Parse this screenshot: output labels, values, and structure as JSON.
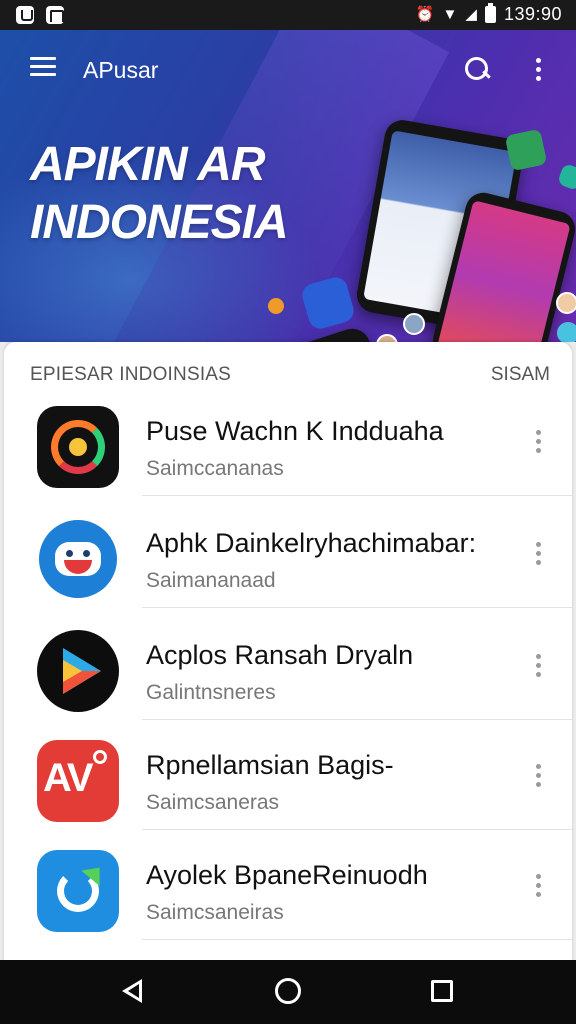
{
  "status_bar": {
    "time": "139:90",
    "icons": [
      "notification-icon",
      "notification-icon",
      "alarm-icon",
      "wifi-icon",
      "signal-icon",
      "battery-icon"
    ]
  },
  "header": {
    "app_title": "APusar",
    "headline_line1": "APIKIN AR",
    "headline_line2": "INDONESIA",
    "icons": [
      "menu-icon",
      "search-icon",
      "more-vert-icon"
    ],
    "colors": {
      "banner_start": "#1d4fa8",
      "banner_end": "#6a2bb0"
    }
  },
  "section": {
    "title": "EPIESAR INDOINSIAS",
    "action": "SISAM"
  },
  "apps": [
    {
      "name": "Puse Wachn K Indduaha",
      "subtitle": "Saimccananas",
      "icon": "ring-logo-icon"
    },
    {
      "name": "Aphk Dainkelryhachimabar:",
      "subtitle": "Saimananaad",
      "icon": "robot-logo-icon"
    },
    {
      "name": "Acplos Ransah Dryaln",
      "subtitle": "Galintnsneres",
      "icon": "play-logo-icon"
    },
    {
      "name": "Rpnellamsian Bagis-",
      "subtitle": "Saimcsaneras",
      "icon": "av-logo-icon"
    },
    {
      "name": "Ayolek BpaneReinuodh",
      "subtitle": "Saimcsaneiras",
      "icon": "sync-logo-icon"
    }
  ],
  "nav_bar": {
    "icons": [
      "back-icon",
      "home-icon",
      "recent-apps-icon"
    ]
  }
}
